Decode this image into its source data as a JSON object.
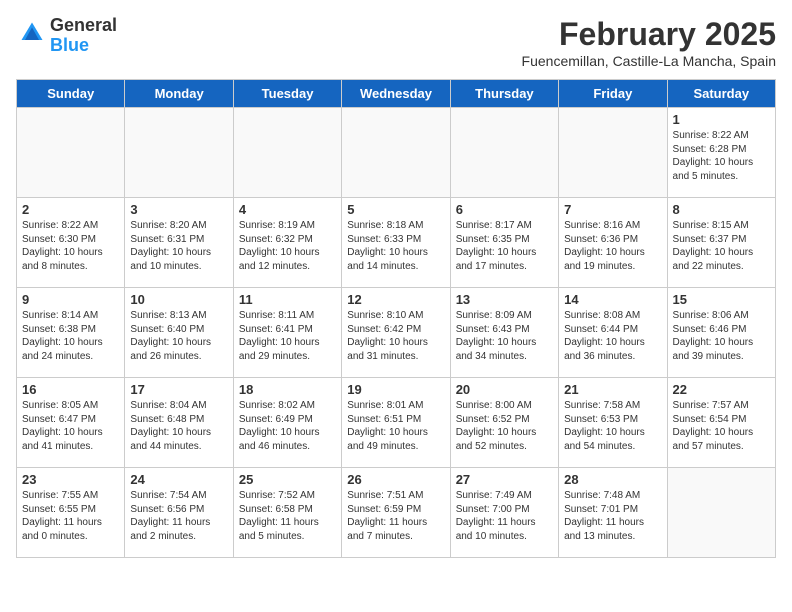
{
  "header": {
    "logo_line1": "General",
    "logo_line2": "Blue",
    "month_title": "February 2025",
    "subtitle": "Fuencemillan, Castille-La Mancha, Spain"
  },
  "days_of_week": [
    "Sunday",
    "Monday",
    "Tuesday",
    "Wednesday",
    "Thursday",
    "Friday",
    "Saturday"
  ],
  "weeks": [
    [
      {
        "day": "",
        "info": ""
      },
      {
        "day": "",
        "info": ""
      },
      {
        "day": "",
        "info": ""
      },
      {
        "day": "",
        "info": ""
      },
      {
        "day": "",
        "info": ""
      },
      {
        "day": "",
        "info": ""
      },
      {
        "day": "1",
        "info": "Sunrise: 8:22 AM\nSunset: 6:28 PM\nDaylight: 10 hours\nand 5 minutes."
      }
    ],
    [
      {
        "day": "2",
        "info": "Sunrise: 8:22 AM\nSunset: 6:30 PM\nDaylight: 10 hours\nand 8 minutes."
      },
      {
        "day": "3",
        "info": "Sunrise: 8:20 AM\nSunset: 6:31 PM\nDaylight: 10 hours\nand 10 minutes."
      },
      {
        "day": "4",
        "info": "Sunrise: 8:19 AM\nSunset: 6:32 PM\nDaylight: 10 hours\nand 12 minutes."
      },
      {
        "day": "5",
        "info": "Sunrise: 8:18 AM\nSunset: 6:33 PM\nDaylight: 10 hours\nand 14 minutes."
      },
      {
        "day": "6",
        "info": "Sunrise: 8:17 AM\nSunset: 6:35 PM\nDaylight: 10 hours\nand 17 minutes."
      },
      {
        "day": "7",
        "info": "Sunrise: 8:16 AM\nSunset: 6:36 PM\nDaylight: 10 hours\nand 19 minutes."
      },
      {
        "day": "8",
        "info": "Sunrise: 8:15 AM\nSunset: 6:37 PM\nDaylight: 10 hours\nand 22 minutes."
      }
    ],
    [
      {
        "day": "9",
        "info": "Sunrise: 8:14 AM\nSunset: 6:38 PM\nDaylight: 10 hours\nand 24 minutes."
      },
      {
        "day": "10",
        "info": "Sunrise: 8:13 AM\nSunset: 6:40 PM\nDaylight: 10 hours\nand 26 minutes."
      },
      {
        "day": "11",
        "info": "Sunrise: 8:11 AM\nSunset: 6:41 PM\nDaylight: 10 hours\nand 29 minutes."
      },
      {
        "day": "12",
        "info": "Sunrise: 8:10 AM\nSunset: 6:42 PM\nDaylight: 10 hours\nand 31 minutes."
      },
      {
        "day": "13",
        "info": "Sunrise: 8:09 AM\nSunset: 6:43 PM\nDaylight: 10 hours\nand 34 minutes."
      },
      {
        "day": "14",
        "info": "Sunrise: 8:08 AM\nSunset: 6:44 PM\nDaylight: 10 hours\nand 36 minutes."
      },
      {
        "day": "15",
        "info": "Sunrise: 8:06 AM\nSunset: 6:46 PM\nDaylight: 10 hours\nand 39 minutes."
      }
    ],
    [
      {
        "day": "16",
        "info": "Sunrise: 8:05 AM\nSunset: 6:47 PM\nDaylight: 10 hours\nand 41 minutes."
      },
      {
        "day": "17",
        "info": "Sunrise: 8:04 AM\nSunset: 6:48 PM\nDaylight: 10 hours\nand 44 minutes."
      },
      {
        "day": "18",
        "info": "Sunrise: 8:02 AM\nSunset: 6:49 PM\nDaylight: 10 hours\nand 46 minutes."
      },
      {
        "day": "19",
        "info": "Sunrise: 8:01 AM\nSunset: 6:51 PM\nDaylight: 10 hours\nand 49 minutes."
      },
      {
        "day": "20",
        "info": "Sunrise: 8:00 AM\nSunset: 6:52 PM\nDaylight: 10 hours\nand 52 minutes."
      },
      {
        "day": "21",
        "info": "Sunrise: 7:58 AM\nSunset: 6:53 PM\nDaylight: 10 hours\nand 54 minutes."
      },
      {
        "day": "22",
        "info": "Sunrise: 7:57 AM\nSunset: 6:54 PM\nDaylight: 10 hours\nand 57 minutes."
      }
    ],
    [
      {
        "day": "23",
        "info": "Sunrise: 7:55 AM\nSunset: 6:55 PM\nDaylight: 11 hours\nand 0 minutes."
      },
      {
        "day": "24",
        "info": "Sunrise: 7:54 AM\nSunset: 6:56 PM\nDaylight: 11 hours\nand 2 minutes."
      },
      {
        "day": "25",
        "info": "Sunrise: 7:52 AM\nSunset: 6:58 PM\nDaylight: 11 hours\nand 5 minutes."
      },
      {
        "day": "26",
        "info": "Sunrise: 7:51 AM\nSunset: 6:59 PM\nDaylight: 11 hours\nand 7 minutes."
      },
      {
        "day": "27",
        "info": "Sunrise: 7:49 AM\nSunset: 7:00 PM\nDaylight: 11 hours\nand 10 minutes."
      },
      {
        "day": "28",
        "info": "Sunrise: 7:48 AM\nSunset: 7:01 PM\nDaylight: 11 hours\nand 13 minutes."
      },
      {
        "day": "",
        "info": ""
      }
    ]
  ]
}
